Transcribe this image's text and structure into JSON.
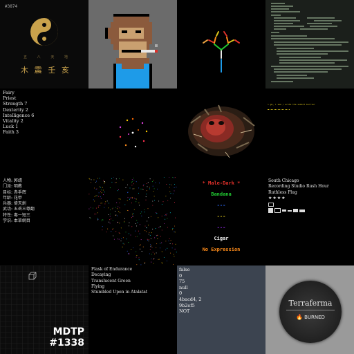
{
  "tiles": {
    "yinyang": {
      "label": "#3874",
      "chars": [
        "木",
        "震",
        "壬",
        "亥"
      ],
      "small_chars": [
        "五",
        "八",
        "天",
        "地"
      ]
    },
    "stats": {
      "lines": [
        "Fairy",
        "Priest",
        "Strength 7",
        "Dexterity 2",
        "Intelligence 6",
        "Vitality 2",
        "Luck 1",
        "Faith 3"
      ]
    },
    "terminal": {
      "text": "> gm, i see / wrote the submit barrier"
    },
    "chinese": {
      "lines": [
        "人物: 郭靖",
        "门派: 明教",
        "目标: 赤手辉",
        "年龄: 花甲",
        "兵器: 倚天劍",
        "武功: 五岳三尊翻",
        "特性: 毒一短三",
        "学识: 本草纲目"
      ]
    },
    "traits": {
      "heading": "* Male-Dark *",
      "item1": "Bandana",
      "item2": "Cigar",
      "item3": "No Expression",
      "dash1": "---",
      "dash2": "---",
      "dash3": "---"
    },
    "chicago": {
      "lines": [
        "South Chicago",
        "Recording Studio Rush Hour",
        "Ruthless Plug"
      ],
      "stars": "★★★★"
    },
    "mdtp": {
      "title": "MDTP",
      "number": "#1338"
    },
    "loot": {
      "lines": [
        "Flask of Endurance",
        "Decaying",
        "Translucent Green",
        "Flying",
        "Stumbled Upon in Atalatat"
      ]
    },
    "values": {
      "lines": [
        "false",
        "0",
        "75",
        "null",
        "0",
        "4bacd4, 2",
        "9b2ef5",
        "NOT"
      ]
    },
    "terraferma": {
      "title": "Terraferma",
      "badge": "BURNED"
    }
  },
  "colors": {
    "gold": "#c9a24c",
    "red": "#e0302a",
    "green": "#22cc33",
    "blue": "#2e6bff",
    "yellow": "#d8c21a",
    "purple": "#9b2ef5",
    "orange": "#ff8c1a"
  }
}
